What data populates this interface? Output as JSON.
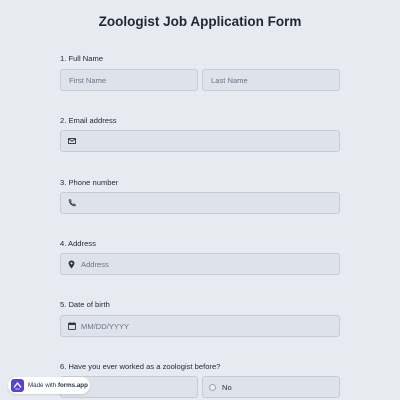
{
  "form": {
    "title": "Zoologist Job Application Form"
  },
  "questions": {
    "q1": {
      "label": "1.  Full Name",
      "first_placeholder": "First Name",
      "last_placeholder": "Last Name"
    },
    "q2": {
      "label": "2. Email address",
      "placeholder": ""
    },
    "q3": {
      "label": "3. Phone number",
      "placeholder": ""
    },
    "q4": {
      "label": "4. Address",
      "placeholder": "Address"
    },
    "q5": {
      "label": "5. Date of birth",
      "placeholder": "MM/DD/YYYY"
    },
    "q6": {
      "label": "6. Have you ever worked as a zoologist before?",
      "option_yes": "",
      "option_no": "No"
    }
  },
  "badge": {
    "prefix": "Made with",
    "brand": "forms.app"
  },
  "icons": {
    "email": "mail-icon",
    "phone": "phone-icon",
    "address": "location-pin-icon",
    "date": "calendar-icon",
    "badge": "forms-app-logo-icon"
  },
  "colors": {
    "background": "#e7eaf1",
    "field_bg": "#dde2eb",
    "field_border": "#c4cbd7",
    "text": "#1f2733",
    "brand_logo": "#5b3fd9"
  }
}
